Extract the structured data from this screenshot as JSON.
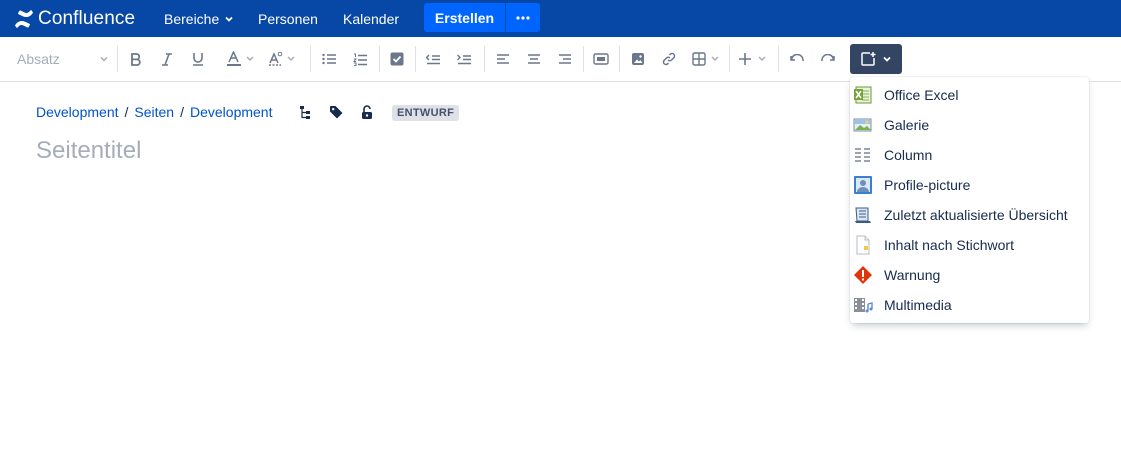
{
  "app": {
    "name": "Confluence"
  },
  "nav": {
    "items": [
      {
        "label": "Bereiche",
        "has_menu": true
      },
      {
        "label": "Personen"
      },
      {
        "label": "Kalender"
      }
    ],
    "create_label": "Erstellen",
    "more_icon": "ellipsis-icon"
  },
  "toolbar": {
    "paragraph_style": "Absatz",
    "tools": [
      "bold-icon",
      "italic-icon",
      "underline-icon",
      "text-color-icon",
      "text-format-icon",
      "bullet-list-icon",
      "numbered-list-icon",
      "task-icon",
      "outdent-icon",
      "indent-icon",
      "align-left-icon",
      "align-center-icon",
      "align-right-icon",
      "layout-icon",
      "image-icon",
      "link-icon",
      "table-icon",
      "insert-more-icon",
      "undo-icon",
      "redo-icon"
    ],
    "insert_button_icon": "insert-macro-icon"
  },
  "breadcrumb": {
    "items": [
      "Development",
      "Seiten",
      "Development"
    ],
    "separator": "/"
  },
  "page_meta": {
    "icons": [
      "page-tree-icon",
      "label-icon",
      "unlock-icon"
    ],
    "status": "ENTWURF"
  },
  "page": {
    "title_placeholder": "Seitentitel"
  },
  "insert_menu": {
    "items": [
      {
        "label": "Office Excel",
        "icon": "excel-icon"
      },
      {
        "label": "Galerie",
        "icon": "gallery-icon"
      },
      {
        "label": "Column",
        "icon": "column-icon"
      },
      {
        "label": "Profile-picture",
        "icon": "profile-picture-icon"
      },
      {
        "label": "Zuletzt aktualisierte Übersicht",
        "icon": "recently-updated-icon"
      },
      {
        "label": "Inhalt nach Stichwort",
        "icon": "content-by-label-icon"
      },
      {
        "label": "Warnung",
        "icon": "warning-icon"
      },
      {
        "label": "Multimedia",
        "icon": "multimedia-icon"
      }
    ]
  },
  "colors": {
    "nav_bg": "#0747a6",
    "primary_button": "#0065ff",
    "link": "#0052cc",
    "insert_button_bg": "#344563",
    "warning": "#de350b"
  }
}
